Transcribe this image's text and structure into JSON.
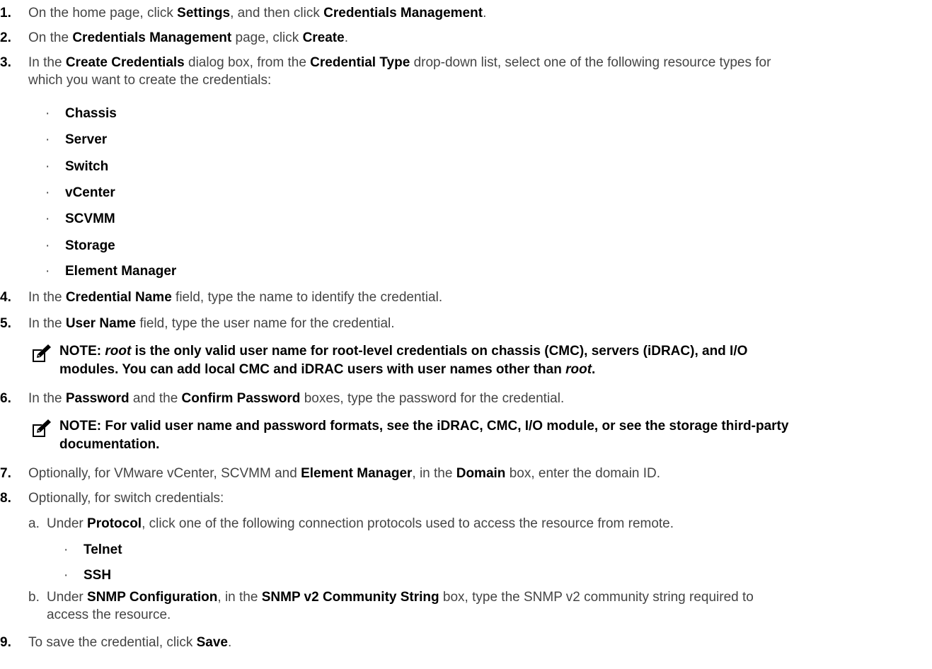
{
  "steps": [
    {
      "num": "1.",
      "parts": [
        "On the home page, click ",
        "Settings",
        ", and then click ",
        "Credentials Management",
        "."
      ]
    },
    {
      "num": "2.",
      "parts": [
        "On the ",
        "Credentials Management",
        " page, click ",
        "Create",
        "."
      ]
    },
    {
      "num": "3.",
      "parts": [
        "In the ",
        "Create Credentials",
        " dialog box, from the ",
        "Credential Type",
        " drop-down list, select one of the following resource types for",
        "which you want to create the credentials:"
      ]
    },
    {
      "num": "4.",
      "parts": [
        "In the ",
        "Credential Name",
        " field, type the name to identify the credential."
      ]
    },
    {
      "num": "5.",
      "parts": [
        "In the ",
        "User Name",
        " field, type the user name for the credential."
      ]
    },
    {
      "num": "6.",
      "parts": [
        "In the ",
        "Password",
        " and the ",
        "Confirm Password",
        " boxes, type the password for the credential."
      ]
    },
    {
      "num": "7.",
      "parts": [
        "Optionally, for VMware vCenter, SCVMM and ",
        "Element Manager",
        ", in the ",
        "Domain",
        " box, enter the domain ID."
      ]
    },
    {
      "num": "8.",
      "parts": [
        "Optionally, for switch credentials:"
      ]
    },
    {
      "num": "9.",
      "parts": [
        "To save the credential, click ",
        "Save",
        "."
      ]
    }
  ],
  "bullet_char": "·",
  "resource_types": [
    "Chassis",
    "Server",
    "Switch",
    "vCenter",
    "SCVMM",
    "Storage",
    "Element Manager"
  ],
  "note1": {
    "prefix": "NOTE: ",
    "root1": "root",
    "line1_rest": " is the only valid user name for root-level credentials on chassis (CMC), servers (iDRAC), and I/O",
    "line2": "modules. You can add local CMC and iDRAC users with user names other than ",
    "root2": "root",
    "end": "."
  },
  "note2": {
    "line1": "NOTE: For valid user name and password formats, see the iDRAC, CMC, I/O module, or see the storage third-party",
    "line2": "documentation."
  },
  "substep_a": {
    "letter": "a.",
    "parts": [
      "Under ",
      "Protocol",
      ", click one of the following connection protocols used to access the resource from remote."
    ],
    "options": [
      "Telnet",
      "SSH"
    ]
  },
  "substep_b": {
    "letter": "b.",
    "parts": [
      "Under ",
      "SNMP Configuration",
      ", in the ",
      "SNMP v2 Community String",
      " box, type the SNMP v2 community string required to"
    ],
    "line2": "access the resource."
  },
  "icon": "note-pencil-icon"
}
